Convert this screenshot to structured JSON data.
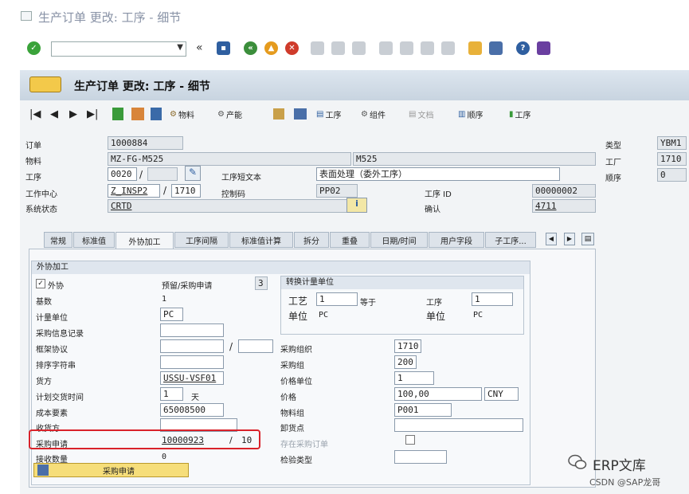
{
  "window": {
    "title": "生产订单 更改: 工序 - 细节"
  },
  "screen": {
    "title": "生产订单 更改: 工序 - 细节"
  },
  "toolbar2": {
    "material": "物料",
    "capacity": "产能",
    "operation": "工序",
    "component": "组件",
    "document": "文档",
    "sequence": "顺序",
    "operation2": "工序"
  },
  "header": {
    "order_label": "订单",
    "order_value": "1000884",
    "material_label": "物料",
    "material_value": "MZ-FG-M525",
    "material_desc": "M525",
    "operation_label": "工序",
    "operation_value": "0020",
    "op_text_label": "工序短文本",
    "op_text_value": "表面处理（委外工序）",
    "workcenter_label": "工作中心",
    "workcenter_value": "Z_INSP2",
    "workcenter_plant": "1710",
    "control_key_label": "控制码",
    "control_key_value": "PP02",
    "op_id_label": "工序 ID",
    "op_id_value": "00000002",
    "status_label": "系统状态",
    "status_value": "CRTD",
    "confirm_label": "确认",
    "confirm_value": "4711",
    "type_label": "类型",
    "type_value": "YBM1",
    "plant_label": "工厂",
    "plant_value": "1710",
    "seq_label": "顺序",
    "seq_value": "0"
  },
  "tabs": [
    "常规",
    "标准值",
    "外协加工",
    "工序间隔",
    "标准值计算",
    "拆分",
    "重叠",
    "日期/时间",
    "用户字段",
    "子工序..."
  ],
  "outsourcing": {
    "group_title": "外协加工",
    "ext_label": "外协",
    "ext_checked": "✓",
    "pr_label": "预留/采购申请",
    "pr_value": "3",
    "base_label": "基数",
    "base_value": "1",
    "unit_label": "计量单位",
    "unit_value": "PC",
    "info_label": "采购信息记录",
    "info_value": "",
    "contract_label": "框架协议",
    "contract_value": "",
    "contract_item": "",
    "sort_label": "排序字符串",
    "sort_value": "",
    "vendor_label": "货方",
    "vendor_value": "USSU-VSF01",
    "delivery_label": "计划交货时间",
    "delivery_value": "1",
    "delivery_unit": "天",
    "cost_label": "成本要素",
    "cost_value": "65008500",
    "recipient_label": "收货方",
    "recipient_value": "",
    "req_label": "采购申请",
    "req_value": "10000923",
    "req_item": "10",
    "recv_qty_label": "接收数量",
    "recv_qty_value": "0",
    "button_label": "采购申请",
    "conv_title": "转换计量单位",
    "conv_op_label": "工艺",
    "conv_op_value": "1",
    "conv_eq": "等于",
    "conv_op2_label": "工序",
    "conv_op2_value": "1",
    "conv_unit_label": "单位",
    "conv_unit_value": "PC",
    "conv_unit2_label": "单位",
    "conv_unit2_value": "PC",
    "porg_label": "采购组织",
    "porg_value": "1710",
    "pgrp_label": "采购组",
    "pgrp_value": "200",
    "punit_label": "价格单位",
    "punit_value": "1",
    "price_label": "价格",
    "price_value": "100,00",
    "currency": "CNY",
    "matgrp_label": "物料组",
    "matgrp_value": "P001",
    "unload_label": "卸货点",
    "unload_value": "",
    "po_exists_label": "存在采购订单",
    "insp_label": "检验类型",
    "insp_value": ""
  },
  "watermark": {
    "brand": "ERP文库",
    "csdn": "CSDN @SAP龙哥"
  },
  "colors": {
    "highlight": "#d9222a",
    "button": "#f6de7a",
    "header": "#dde6ef"
  }
}
